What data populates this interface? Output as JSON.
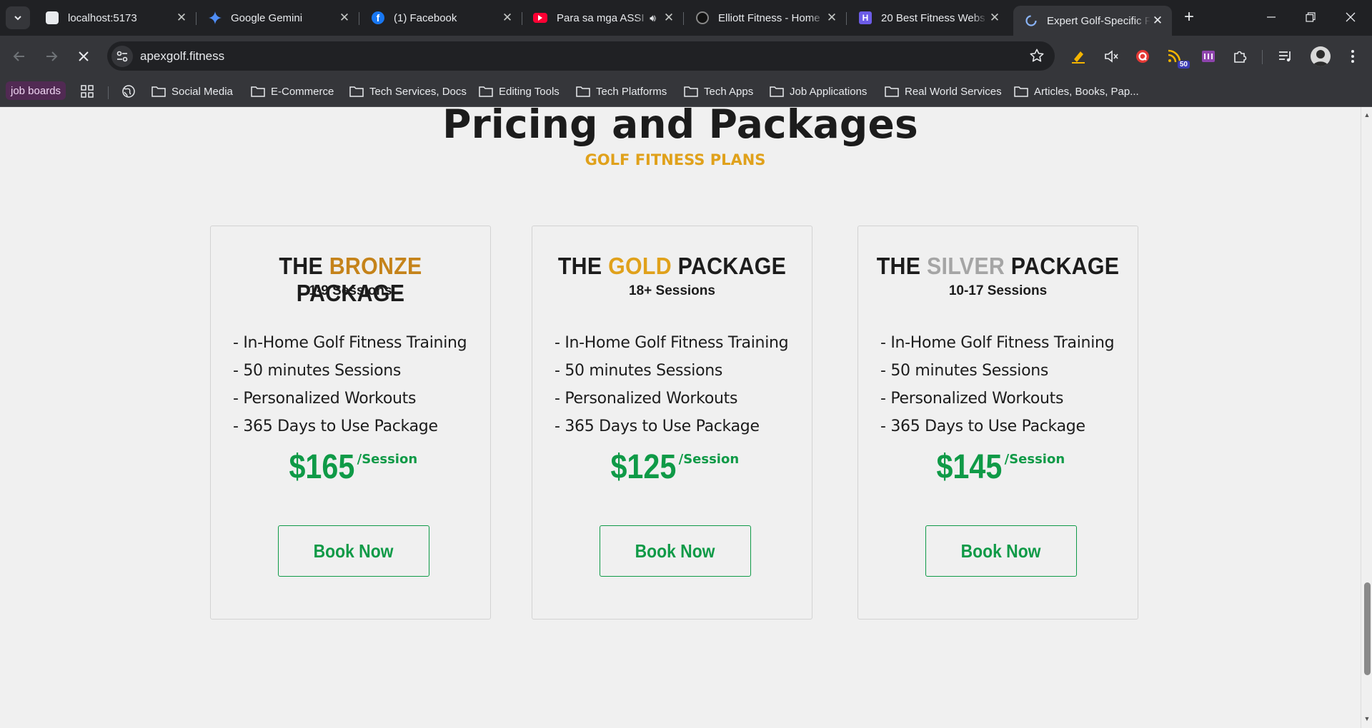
{
  "browser": {
    "tabs": [
      {
        "title": "localhost:5173",
        "icon": "page-icon",
        "active": false
      },
      {
        "title": "Google Gemini",
        "icon": "gemini-icon",
        "active": false
      },
      {
        "title": "(1) Facebook",
        "icon": "facebook-icon",
        "active": false
      },
      {
        "title": "Para sa mga ASSI",
        "icon": "youtube-icon",
        "active": false,
        "audio": true
      },
      {
        "title": "Elliott Fitness - Home",
        "icon": "elliott-icon",
        "active": false
      },
      {
        "title": "20 Best Fitness Webs",
        "icon": "h-logo-icon",
        "active": false
      },
      {
        "title": "Expert Golf-Specific F",
        "icon": "loading-icon",
        "active": true
      }
    ],
    "url": "apexgolf.fitness",
    "extension_badge": "50",
    "bookmarks": {
      "pinned": "job boards",
      "folders": [
        "Social Media",
        "E-Commerce",
        "Tech Services, Docs",
        "Editing Tools",
        "Tech Platforms",
        "Tech Apps",
        "Job Applications",
        "Real World Services",
        "Articles, Books, Pap..."
      ]
    }
  },
  "page": {
    "heading": "Pricing and Packages",
    "subheading": "GOLF FITNESS PLANS",
    "colors": {
      "accent_gold": "#e0a11b",
      "price_green": "#0f9a47",
      "bronze": "#c5831a",
      "silver": "#a5a5a5"
    },
    "packages": [
      {
        "title_prefix": "THE",
        "title_metal": "BRONZE",
        "title_suffix": "PACKAGE",
        "metal_color": "#c5831a",
        "sessions": "1-9 Sessions",
        "features": [
          "- In-Home Golf Fitness Training",
          "- 50 minutes Sessions",
          "- Personalized Workouts",
          "- 365 Days to Use Package"
        ],
        "price": "$165",
        "per": "/Session",
        "button": "Book Now"
      },
      {
        "title_prefix": "THE",
        "title_metal": "GOLD",
        "title_suffix": "PACKAGE",
        "metal_color": "#e0a11b",
        "sessions": "18+ Sessions",
        "features": [
          "- In-Home Golf Fitness Training",
          "- 50 minutes Sessions",
          "- Personalized Workouts",
          "- 365 Days to Use Package"
        ],
        "price": "$125",
        "per": "/Session",
        "button": "Book Now"
      },
      {
        "title_prefix": "THE",
        "title_metal": "SILVER",
        "title_suffix": "PACKAGE",
        "metal_color": "#a5a5a5",
        "sessions": "10-17 Sessions",
        "features": [
          "- In-Home Golf Fitness Training",
          "- 50 minutes Sessions",
          "- Personalized Workouts",
          "- 365 Days to Use Package"
        ],
        "price": "$145",
        "per": "/Session",
        "button": "Book Now"
      }
    ]
  }
}
